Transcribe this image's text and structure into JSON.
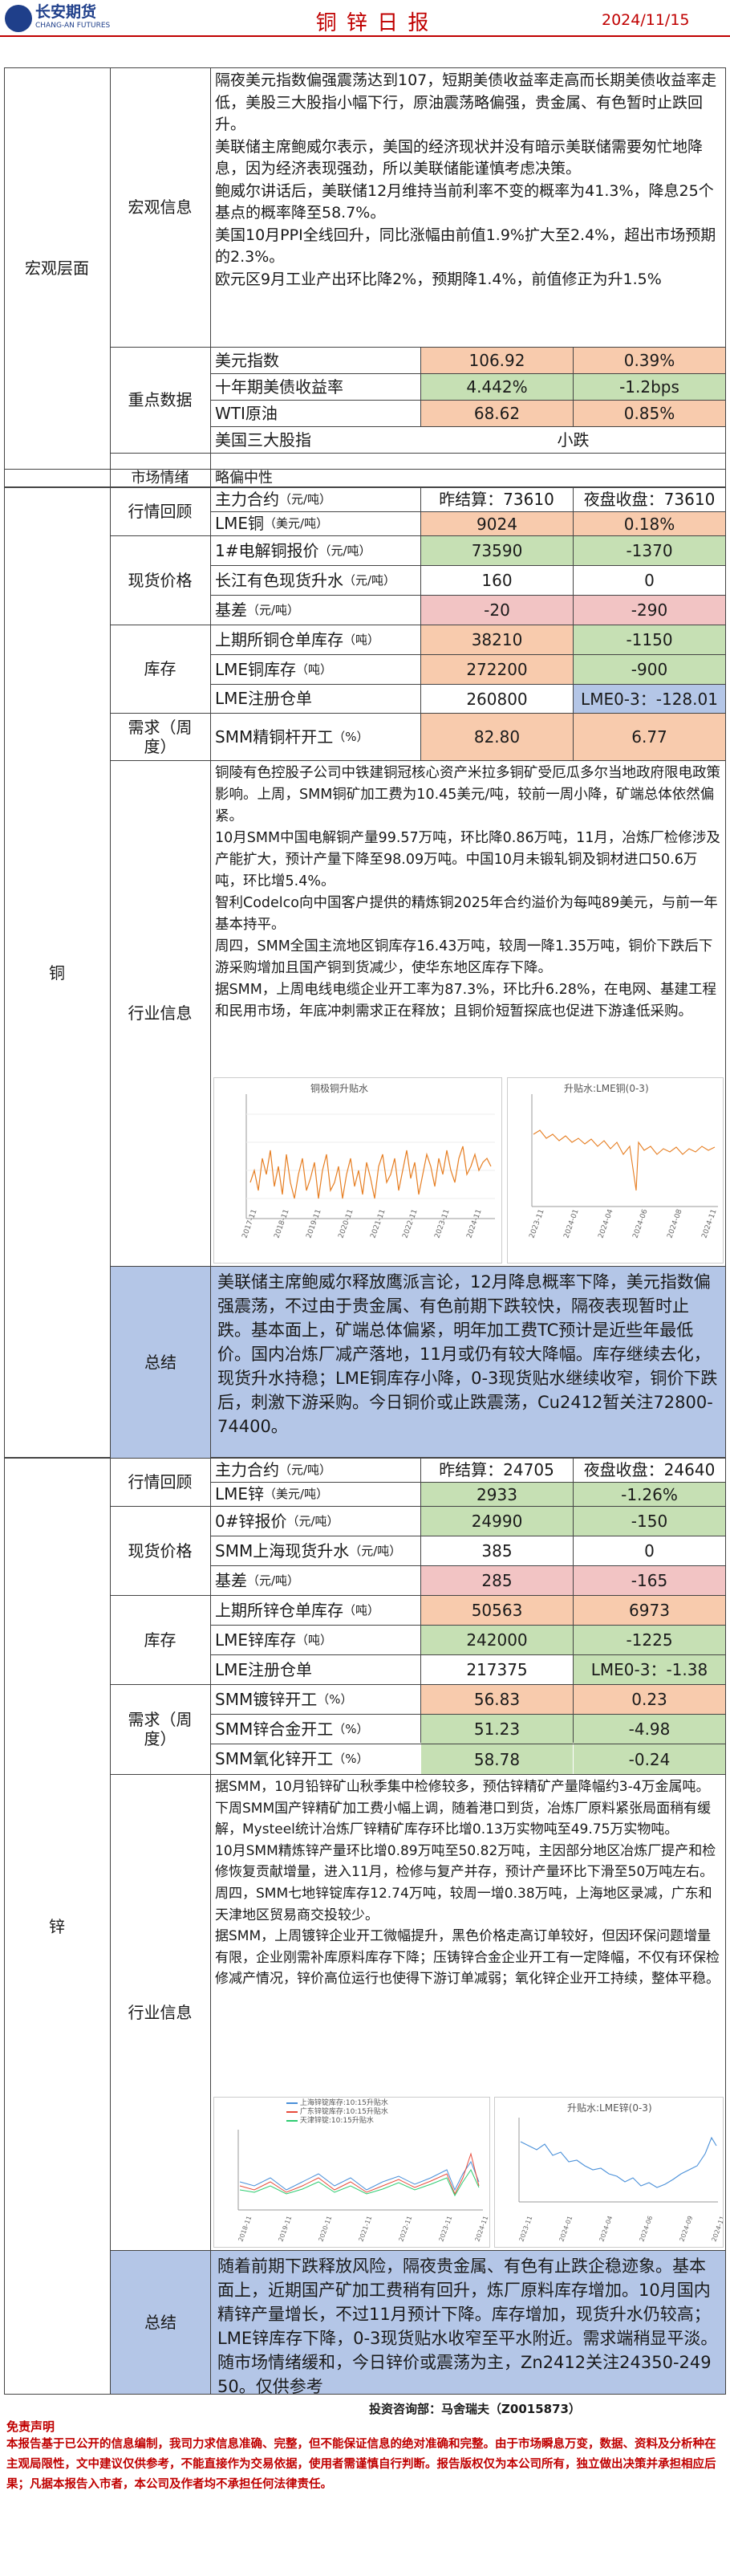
{
  "header": {
    "logo_cn": "长安期货",
    "logo_en": "CHANG-AN FUTURES",
    "title": "铜 锌 日 报",
    "date": "2024/11/15"
  },
  "macro": {
    "section": "宏观层面",
    "news_label": "宏观信息",
    "news": "隔夜美元指数偏强震荡达到107，短期美债收益率走高而长期美债收益率走低，美股三大股指小幅下行，原油震荡略偏强，贵金属、有色暂时止跌回升。\n美联储主席鲍威尔表示，美国的经济现状并没有暗示美联储需要匆忙地降息，因为经济表现强劲，所以美联储能谨慎考虑决策。\n鲍威尔讲话后，美联储12月维持当前利率不变的概率为41.3%，降息25个基点的概率降至58.7%。\n美国10月PPI全线回升，同比涨幅由前值1.9%扩大至2.4%，超出市场预期的2.3%。\n欧元区9月工业产出环比降2%，预期降1.4%，前值修正为升1.5%",
    "key_label": "重点数据",
    "key_rows": [
      {
        "name": "美元指数",
        "value": "106.92",
        "change": "0.39%"
      },
      {
        "name": "十年期美债收益率",
        "value": "4.442%",
        "change": "-1.2bps"
      },
      {
        "name": "WTI原油",
        "value": "68.62",
        "change": "0.85%"
      },
      {
        "name": "美国三大股指",
        "value": "",
        "change": "小跌"
      }
    ],
    "mood_label": "市场情绪",
    "mood": "略偏中性"
  },
  "copper": {
    "section": "铜",
    "market_label": "行情回顾",
    "main_contract": "主力合约",
    "main_unit": "（元/吨）",
    "settle": "昨结算：73610",
    "night": "夜盘收盘：73610",
    "lme_label": "LME铜",
    "lme_unit": "（美元/吨）",
    "lme_value": "9024",
    "lme_change": "0.18%",
    "spot_label": "现货价格",
    "spot_rows": [
      {
        "name": "1#电解铜报价",
        "unit": "（元/吨）",
        "value": "73590",
        "change": "-1370"
      },
      {
        "name": "长江有色现货升水",
        "unit": "（元/吨）",
        "value": "160",
        "change": "0"
      },
      {
        "name": "基差",
        "unit": "（元/吨）",
        "value": "-20",
        "change": "-290"
      }
    ],
    "inv_label": "库存",
    "inv_rows": [
      {
        "name": "上期所铜仓单库存",
        "unit": "（吨）",
        "value": "38210",
        "change": "-1150"
      },
      {
        "name": "LME铜库存",
        "unit": "（吨）",
        "value": "272200",
        "change": "-900"
      },
      {
        "name": "LME注册仓单",
        "unit": "",
        "value": "260800",
        "change": "LME0-3：-128.01"
      }
    ],
    "demand_label": "需求（周度）",
    "demand_rows": [
      {
        "name": "SMM精铜杆开工",
        "unit": "（%）",
        "value": "82.80",
        "change": "6.77"
      }
    ],
    "industry_label": "行业信息",
    "industry": "铜陵有色控股子公司中铁建铜冠核心资产米拉多铜矿受厄瓜多尔当地政府限电政策影响。上周，SMM铜矿加工费为10.45美元/吨，较前一周小降，矿端总体依然偏紧。\n10月SMM中国电解铜产量99.57万吨，环比降0.86万吨，11月，冶炼厂检修涉及产能扩大，预计产量下降至98.09万吨。中国10月未锻轧铜及铜材进口50.6万吨，环比增5.4%。\n智利Codelco向中国客户提供的精炼铜2025年合约溢价为每吨89美元，与前一年基本持平。\n周四，SMM全国主流地区铜库存16.43万吨，较周一降1.35万吨，铜价下跌后下游采购增加且国产铜到货减少，使华东地区库存下降。\n据SMM，上周电线电缆企业开工率为87.3%，环比升6.28%，在电网、基建工程和民用市场，年底冲刺需求正在释放；且铜价短暂探底也促进下游逢低采购。",
    "chart1_title": "铜极铜升贴水",
    "chart2_title": "升贴水:LME铜(0-3)",
    "summary_label": "总结",
    "summary": "美联储主席鲍威尔释放鹰派言论，12月降息概率下降，美元指数偏强震荡，不过由于贵金属、有色前期下跌较快，隔夜表现暂时止跌。基本面上，矿端总体偏紧，明年加工费TC预计是近些年最低价。国内冶炼厂减产落地，11月或仍有较大降幅。库存继续去化，现货升水持稳；LME铜库存小降，0-3现货贴水继续收窄，铜价下跌后，刺激下游采购。今日铜价或止跌震荡，Cu2412暂关注72800-74400。"
  },
  "zinc": {
    "section": "锌",
    "market_label": "行情回顾",
    "main_contract": "主力合约",
    "main_unit": "（元/吨）",
    "settle": "昨结算：24705",
    "night": "夜盘收盘：24640",
    "lme_label": "LME锌",
    "lme_unit": "（美元/吨）",
    "lme_value": "2933",
    "lme_change": "-1.26%",
    "spot_label": "现货价格",
    "spot_rows": [
      {
        "name": "0#锌报价",
        "unit": "（元/吨）",
        "value": "24990",
        "change": "-150"
      },
      {
        "name": "SMM上海现货升水",
        "unit": "（元/吨）",
        "value": "385",
        "change": "0"
      },
      {
        "name": "基差",
        "unit": "（元/吨）",
        "value": "285",
        "change": "-165"
      }
    ],
    "inv_label": "库存",
    "inv_rows": [
      {
        "name": "上期所锌仓单库存",
        "unit": "（吨）",
        "value": "50563",
        "change": "6973"
      },
      {
        "name": "LME锌库存",
        "unit": "（吨）",
        "value": "242000",
        "change": "-1225"
      },
      {
        "name": "LME注册仓单",
        "unit": "",
        "value": "217375",
        "change": "LME0-3：-1.38"
      }
    ],
    "demand_label": "需求（周度）",
    "demand_rows": [
      {
        "name": "SMM镀锌开工",
        "unit": "（%）",
        "value": "56.83",
        "change": "0.23"
      },
      {
        "name": "SMM锌合金开工",
        "unit": "（%）",
        "value": "51.23",
        "change": "-4.98"
      },
      {
        "name": "SMM氧化锌开工",
        "unit": "（%）",
        "value": "58.78",
        "change": "-0.24"
      }
    ],
    "industry_label": "行业信息",
    "industry": "据SMM，10月铅锌矿山秋季集中检修较多，预估锌精矿产量降幅约3-4万金属吨。下周SMM国产锌精矿加工费小幅上调，随着港口到货，冶炼厂原料紧张局面稍有缓解，Mysteel统计冶炼厂锌精矿库存环比增0.13万实物吨至49.75万实物吨。\n10月SMM精炼锌产量环比增0.89万吨至50.82万吨，主因部分地区冶炼厂提产和检修恢复贡献增量，进入11月，检修与复产并存，预计产量环比下滑至50万吨左右。\n周四，SMM七地锌锭库存12.74万吨，较周一增0.38万吨，上海地区录减，广东和天津地区贸易商交投较少。\n据SMM，上周镀锌企业开工微幅提升，黑色价格走高订单较好，但因环保问题增量有限，企业刚需补库原料库存下降；压铸锌合金企业开工有一定降幅，不仅有环保检修减产情况，锌价高位运行也使得下游订单减弱；氧化锌企业开工持续，整体平稳。",
    "chart1_legend": [
      "上海锌锭库存:10:15升贴水",
      "广东锌锭库存:10:15升贴水",
      "天津锌锭:10:15升贴水"
    ],
    "chart2_title": "升贴水:LME锌(0-3)",
    "summary_label": "总结",
    "summary": "随着前期下跌释放风险，隔夜贵金属、有色有止跌企稳迹象。基本面上，近期国产矿加工费稍有回升，炼厂原料库存增加。10月国内精锌产量增长，不过11月预计下降。库存增加，现货升水仍较高；LME锌库存下降，0-3现货贴水收窄至平水附近。需求端稍显平淡。随市场情绪缓和，今日锌价或震荡为主，Zn2412关注24350-24950。仅供参考"
  },
  "footer": {
    "analyst": "投资咨询部：马舍瑞夫（Z0015873）",
    "disclaimer_title": "免责声明",
    "disclaimer": "本报告基于已公开的信息编制，我司力求信息准确、完整，但不能保证信息的绝对准确和完整。由于市场瞬息万变，数据、资料及分析种在主观局限性，文中建议仅供参考，不能直接作为交易依据，使用者需谨慎自行判断。报告版权仅为本公司所有，独立做出决策并承担相应后果；凡据本报告入市者，本公司及作者均不承担任何法律责任。"
  },
  "colors": {
    "title_red": "#c00000",
    "logo_blue": "#1f3f8a",
    "green": "#c6e0b4",
    "pink": "#f2c4c4",
    "orange": "#f8cbad",
    "blue": "#b4c6e7",
    "chart_line": "#e67e22",
    "chart_line2": "#4a90d9"
  }
}
